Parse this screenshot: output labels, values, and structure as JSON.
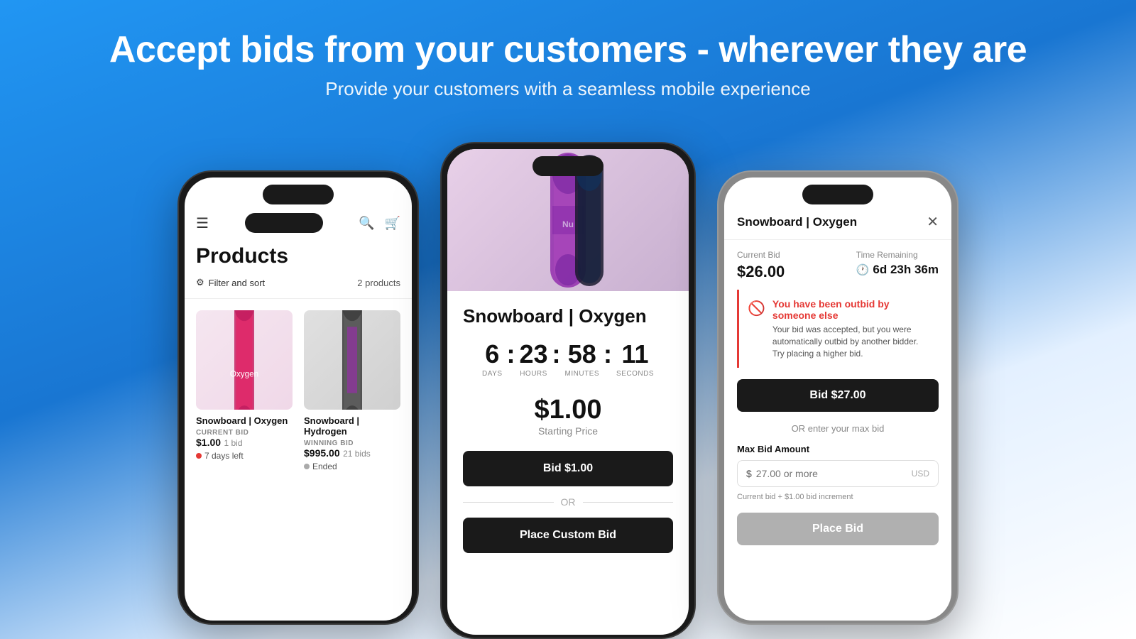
{
  "header": {
    "title": "Accept bids from your customers - wherever they are",
    "subtitle": "Provide your customers with a seamless mobile experience"
  },
  "phone_left": {
    "products_title": "Products",
    "filter_label": "Filter and sort",
    "products_count": "2 products",
    "product1": {
      "name": "Snowboard | Oxygen",
      "bid_label": "CURRENT BID",
      "price": "$1.00",
      "bids": "1 bid",
      "status": "7 days left"
    },
    "product2": {
      "name": "Snowboard | Hydrogen",
      "bid_label": "WINNING BID",
      "price": "$995.00",
      "bids": "21 bids",
      "status": "Ended"
    }
  },
  "phone_center": {
    "product_title": "Snowboard | Oxygen",
    "countdown": {
      "days": "6",
      "hours": "23",
      "minutes": "58",
      "seconds": "11",
      "days_label": "DAYS",
      "hours_label": "HOURS",
      "minutes_label": "MINUTES",
      "seconds_label": "SECONDS"
    },
    "price": "$1.00",
    "price_label": "Starting Price",
    "bid_button": "Bid $1.00",
    "or_text": "OR",
    "custom_bid_button": "Place Custom Bid"
  },
  "phone_right": {
    "modal_title": "Snowboard | Oxygen",
    "close_button": "✕",
    "current_bid_label": "Current Bid",
    "current_bid_value": "$26.00",
    "time_remaining_label": "Time Remaining",
    "time_remaining_value": "6d 23h 36m",
    "outbid_title": "You have been outbid by someone else",
    "outbid_text": "Your bid was accepted, but you were automatically outbid by another bidder. Try placing a higher bid.",
    "bid_button": "Bid $27.00",
    "or_text": "OR enter your max bid",
    "max_bid_label": "Max Bid Amount",
    "max_bid_placeholder": "27.00 or more",
    "usd_label": "USD",
    "bid_increment_note": "Current bid + $1.00 bid increment",
    "place_bid_button": "Place Bid"
  }
}
